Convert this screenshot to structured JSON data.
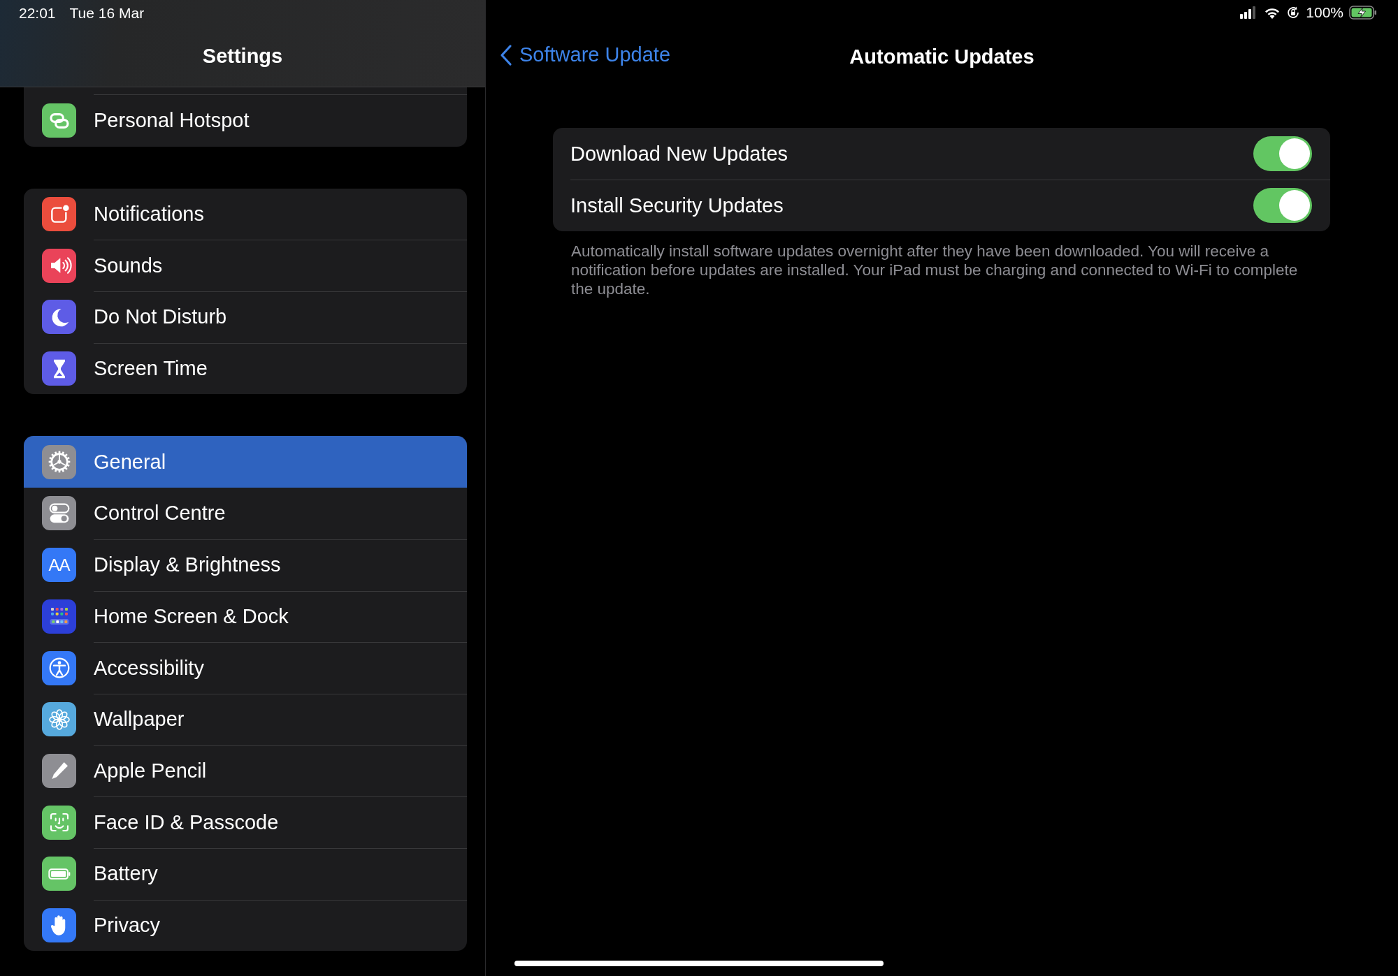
{
  "status_bar": {
    "time": "22:01",
    "date": "Tue 16 Mar",
    "battery": "100%"
  },
  "sidebar": {
    "title": "Settings",
    "groups": [
      {
        "clipped_top": true,
        "items": [
          {
            "label": "Personal Hotspot",
            "kind": "hotspot",
            "color": "#65c466",
            "selected": false
          }
        ]
      },
      {
        "clipped_top": false,
        "items": [
          {
            "label": "Notifications",
            "kind": "notifications",
            "color": "#eb4d3d",
            "selected": false
          },
          {
            "label": "Sounds",
            "kind": "sounds",
            "color": "#ea4359",
            "selected": false
          },
          {
            "label": "Do Not Disturb",
            "kind": "moon",
            "color": "#5e5ce6",
            "selected": false
          },
          {
            "label": "Screen Time",
            "kind": "hourglass",
            "color": "#5e5ce6",
            "selected": false
          }
        ]
      },
      {
        "clipped_top": false,
        "items": [
          {
            "label": "General",
            "kind": "gear",
            "color": "#8e8e93",
            "selected": true
          },
          {
            "label": "Control Centre",
            "kind": "switches",
            "color": "#8e8e93",
            "selected": false
          },
          {
            "label": "Display & Brightness",
            "kind": "text",
            "icon_text": "AA",
            "color": "#3478f6",
            "selected": false
          },
          {
            "label": "Home Screen & Dock",
            "kind": "grid",
            "color": "#2c3fd8",
            "selected": false
          },
          {
            "label": "Accessibility",
            "kind": "accessibility",
            "color": "#3478f6",
            "selected": false
          },
          {
            "label": "Wallpaper",
            "kind": "flower",
            "color": "#56a9dd",
            "selected": false
          },
          {
            "label": "Apple Pencil",
            "kind": "pencil",
            "color": "#8e8e93",
            "selected": false
          },
          {
            "label": "Face ID & Passcode",
            "kind": "face",
            "color": "#65c466",
            "selected": false
          },
          {
            "label": "Battery",
            "kind": "battery",
            "color": "#65c466",
            "selected": false
          },
          {
            "label": "Privacy",
            "kind": "hand",
            "color": "#3478f6",
            "selected": false
          }
        ]
      }
    ]
  },
  "detail": {
    "back": "Software Update",
    "title": "Automatic Updates",
    "toggles": [
      {
        "label": "Download New Updates",
        "on": true
      },
      {
        "label": "Install Security Updates",
        "on": true
      }
    ],
    "footer": "Automatically install software updates overnight after they have been downloaded. You will receive a notification before updates are installed. Your iPad must be charging and connected to Wi-Fi to complete the update."
  }
}
